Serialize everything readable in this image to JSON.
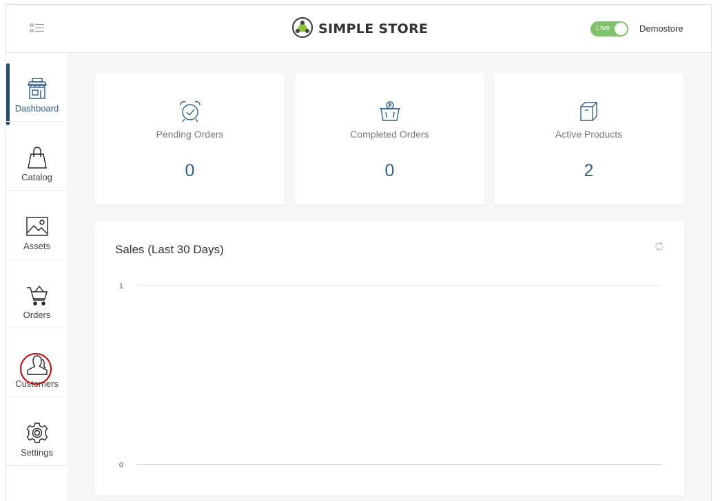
{
  "header": {
    "logo_text": "SIMPLE STORE",
    "live_label": "Live",
    "store_name": "Demostore",
    "menu_icon": "menu-icon",
    "logo_icon": "store-logo-icon",
    "accent_color": "#7cc36a"
  },
  "sidebar": {
    "items": [
      {
        "label": "Dashboard",
        "icon": "storefront-icon",
        "active": true
      },
      {
        "label": "Catalog",
        "icon": "shopping-bag-icon",
        "active": false
      },
      {
        "label": "Assets",
        "icon": "image-icon",
        "active": false
      },
      {
        "label": "Orders",
        "icon": "cart-icon",
        "active": false
      },
      {
        "label": "Customers",
        "icon": "user-icon",
        "active": false
      },
      {
        "label": "Settings",
        "icon": "gear-icon",
        "active": false
      }
    ]
  },
  "stats": [
    {
      "label": "Pending Orders",
      "value": "0",
      "icon": "alarm-clock-icon"
    },
    {
      "label": "Completed Orders",
      "value": "0",
      "icon": "money-basket-icon"
    },
    {
      "label": "Active Products",
      "value": "2",
      "icon": "box-icon"
    }
  ],
  "sales_chart": {
    "title": "Sales (Last 30 Days)",
    "refresh_icon": "refresh-icon"
  },
  "chart_data": {
    "type": "line",
    "title": "Sales (Last 30 Days)",
    "xlabel": "",
    "ylabel": "",
    "y_ticks": [
      "1",
      "0"
    ],
    "ylim": [
      0,
      1
    ],
    "series": [],
    "grid": true
  },
  "colors": {
    "value_blue": "#2f5f8c",
    "active_bar": "#1f4e79"
  }
}
